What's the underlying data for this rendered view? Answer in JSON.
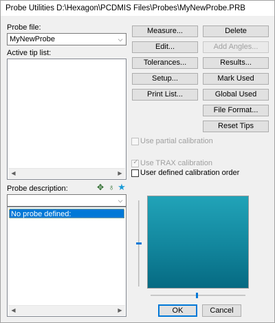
{
  "window": {
    "title": "Probe Utilities  D:\\Hexagon\\PCDMIS Files\\Probes\\MyNewProbe.PRB"
  },
  "probe_file": {
    "label": "Probe file:",
    "value": "MyNewProbe"
  },
  "active_tip_list": {
    "label": "Active tip list:"
  },
  "probe_description": {
    "label": "Probe description:",
    "value": "",
    "items": [
      "No probe defined:"
    ]
  },
  "buttons": {
    "measure": "Measure...",
    "edit": "Edit...",
    "tolerances": "Tolerances...",
    "setup": "Setup...",
    "print_list": "Print List...",
    "delete": "Delete",
    "add_angles": "Add Angles...",
    "results": "Results...",
    "mark_used": "Mark Used",
    "global_used": "Global Used",
    "file_format": "File Format...",
    "reset_tips": "Reset Tips",
    "ok": "OK",
    "cancel": "Cancel"
  },
  "checkboxes": {
    "partial_calibration": {
      "label": "Use partial calibration",
      "checked": false,
      "enabled": false
    },
    "trax_calibration": {
      "label": "Use TRAX calibration",
      "checked": true,
      "enabled": false
    },
    "user_order": {
      "label": "User defined calibration order",
      "checked": false,
      "enabled": true
    }
  },
  "icons": {
    "dropdown": "chevron-down-icon",
    "scroll_left": "scroll-left-icon",
    "scroll_right": "scroll-right-icon",
    "check": "checkmark-icon",
    "add_component": "add-component-icon",
    "probe_config": "probe-config-icon",
    "favorite": "star-icon"
  },
  "colors": {
    "selection": "#0078d7",
    "preview_top": "#21a3b8",
    "preview_bottom": "#066a82",
    "star": "#1a9bd7"
  }
}
